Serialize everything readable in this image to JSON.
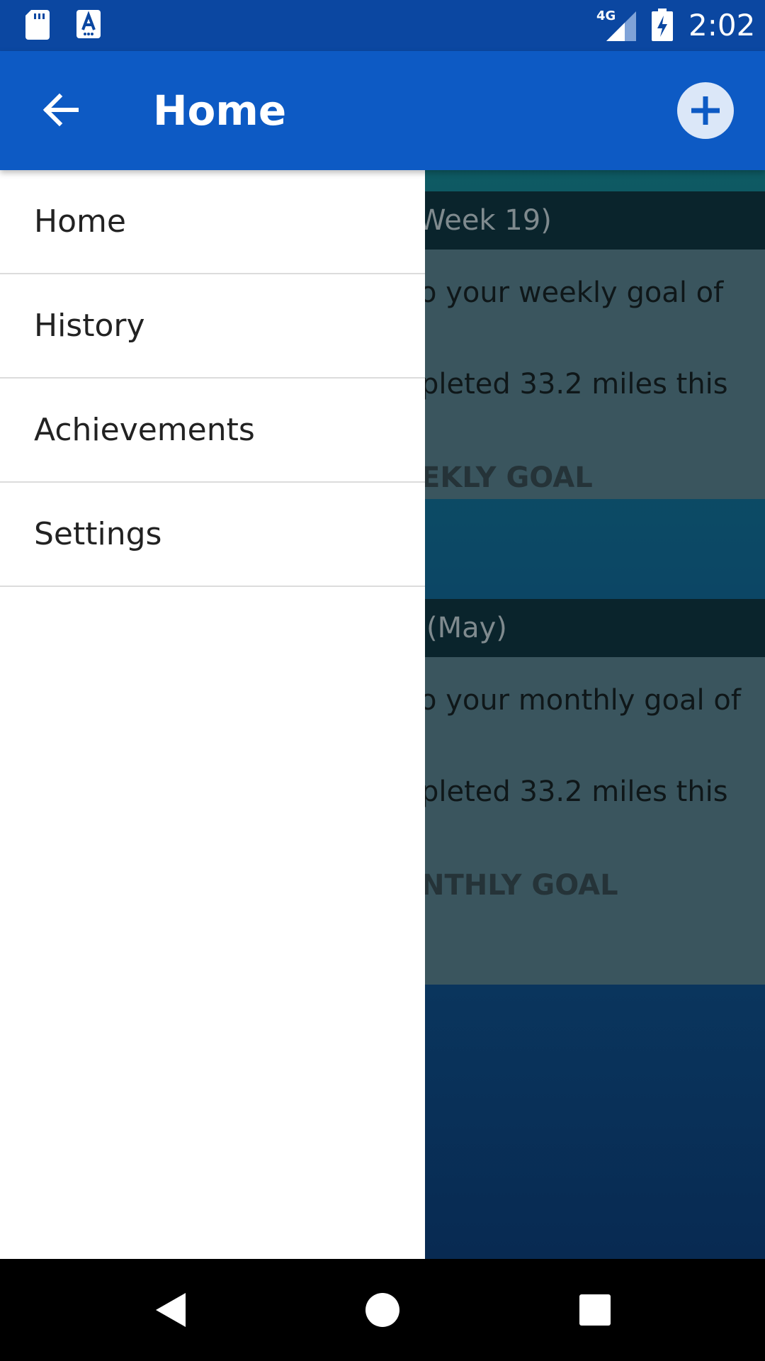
{
  "status_bar": {
    "time": "2:02",
    "network": "4G",
    "icons": [
      "sd-card-icon",
      "keyboard-a-icon",
      "signal-4g-icon",
      "battery-charging-icon"
    ]
  },
  "app_bar": {
    "title": "Home",
    "back_icon": "arrow-left-icon",
    "add_icon": "plus-circle-icon"
  },
  "drawer": {
    "items": [
      {
        "label": "Home"
      },
      {
        "label": "History"
      },
      {
        "label": "Achievements"
      },
      {
        "label": "Settings"
      }
    ]
  },
  "background_cards": [
    {
      "header": "Week 19)",
      "line1": "o your weekly goal of",
      "line2": "pleted 33.2 miles this",
      "action": "EKLY GOAL"
    },
    {
      "header": "(May)",
      "line1": "o your monthly goal of",
      "line2": "pleted 33.2 miles this",
      "action": "NTHLY GOAL"
    }
  ],
  "nav_bar": {
    "back": "back-triangle-icon",
    "home": "home-circle-icon",
    "recents": "recents-square-icon"
  },
  "colors": {
    "status_bar": "#0b47a1",
    "app_bar": "#0d5ac4",
    "drawer": "#ffffff",
    "nav_bar": "#000000"
  }
}
